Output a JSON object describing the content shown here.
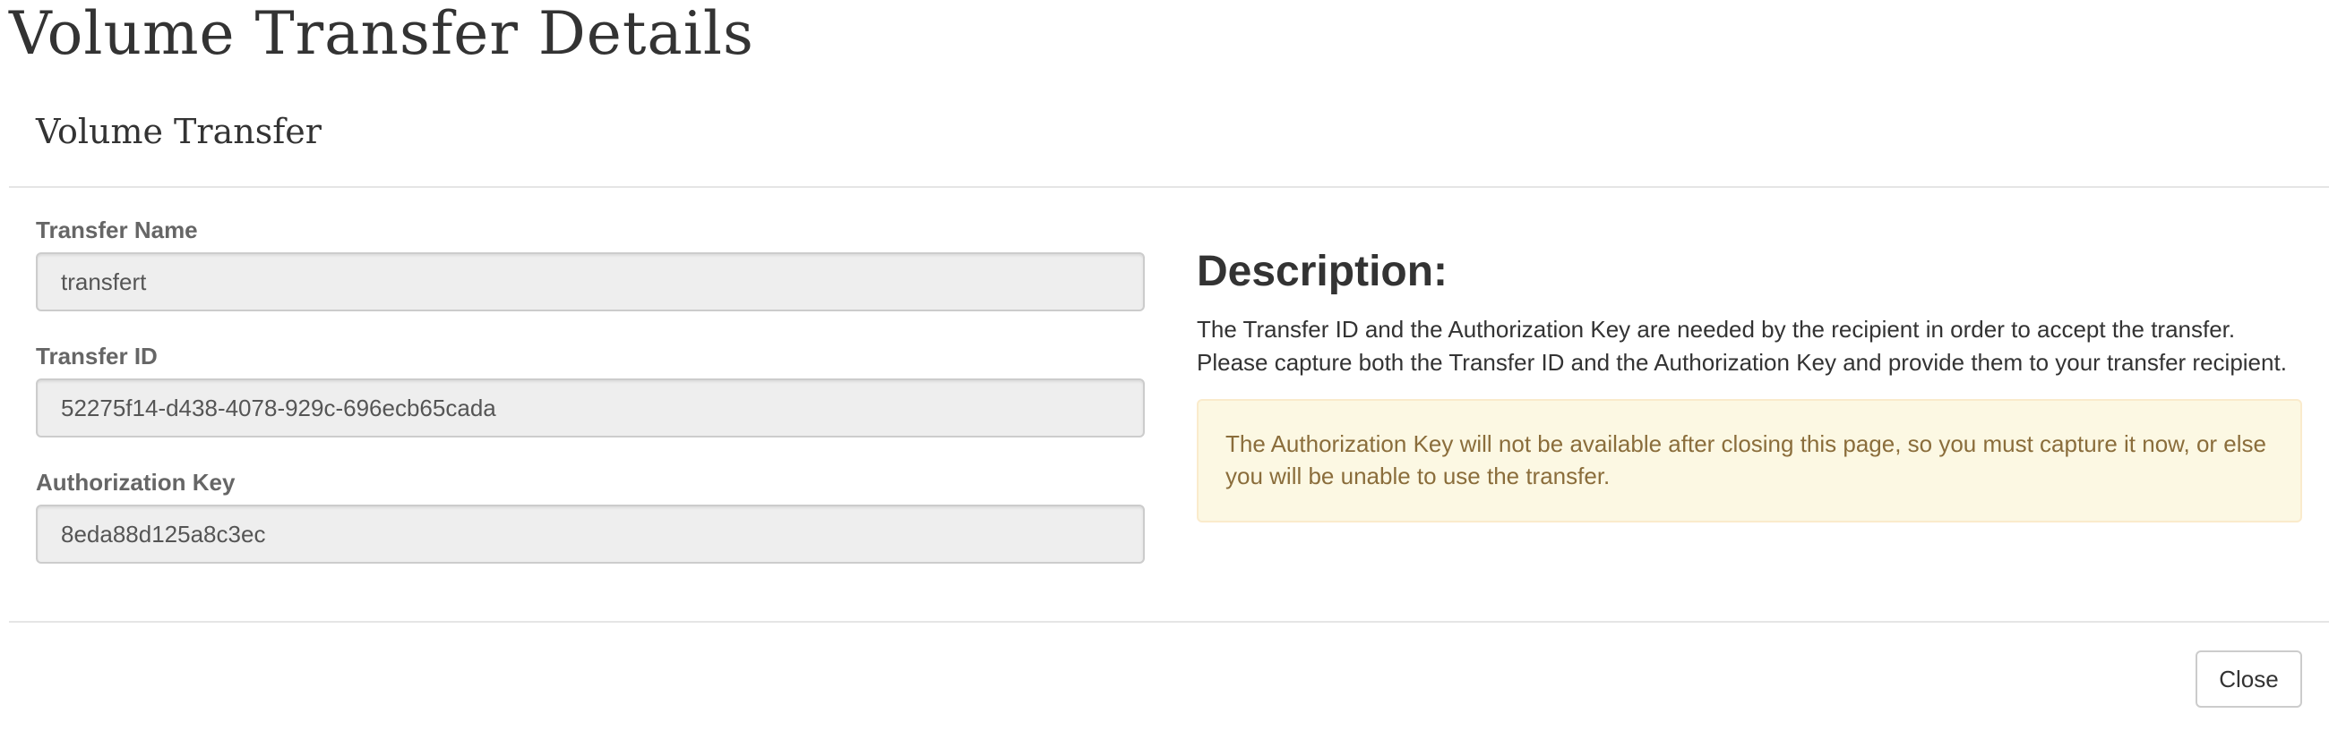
{
  "page": {
    "title": "Volume Transfer Details"
  },
  "modal": {
    "title": "Volume Transfer",
    "fields": [
      {
        "label": "Transfer Name",
        "value": "transfert"
      },
      {
        "label": "Transfer ID",
        "value": "52275f14-d438-4078-929c-696ecb65cada"
      },
      {
        "label": "Authorization Key",
        "value": "8eda88d125a8c3ec"
      }
    ],
    "description": {
      "heading": "Description:",
      "line1": "The Transfer ID and the Authorization Key are needed by the recipient in order to accept the transfer.",
      "line2": "Please capture both the Transfer ID and the Authorization Key and provide them to your transfer recipient."
    },
    "warning": "The Authorization Key will not be available after closing this page, so you must capture it now, or else you will be unable to use the transfer.",
    "close_label": "Close"
  },
  "colors": {
    "warning_background": "#fcf8e3",
    "warning_border": "#faebcc",
    "warning_text": "#8a6d3b",
    "input_background": "#eeeeee"
  }
}
